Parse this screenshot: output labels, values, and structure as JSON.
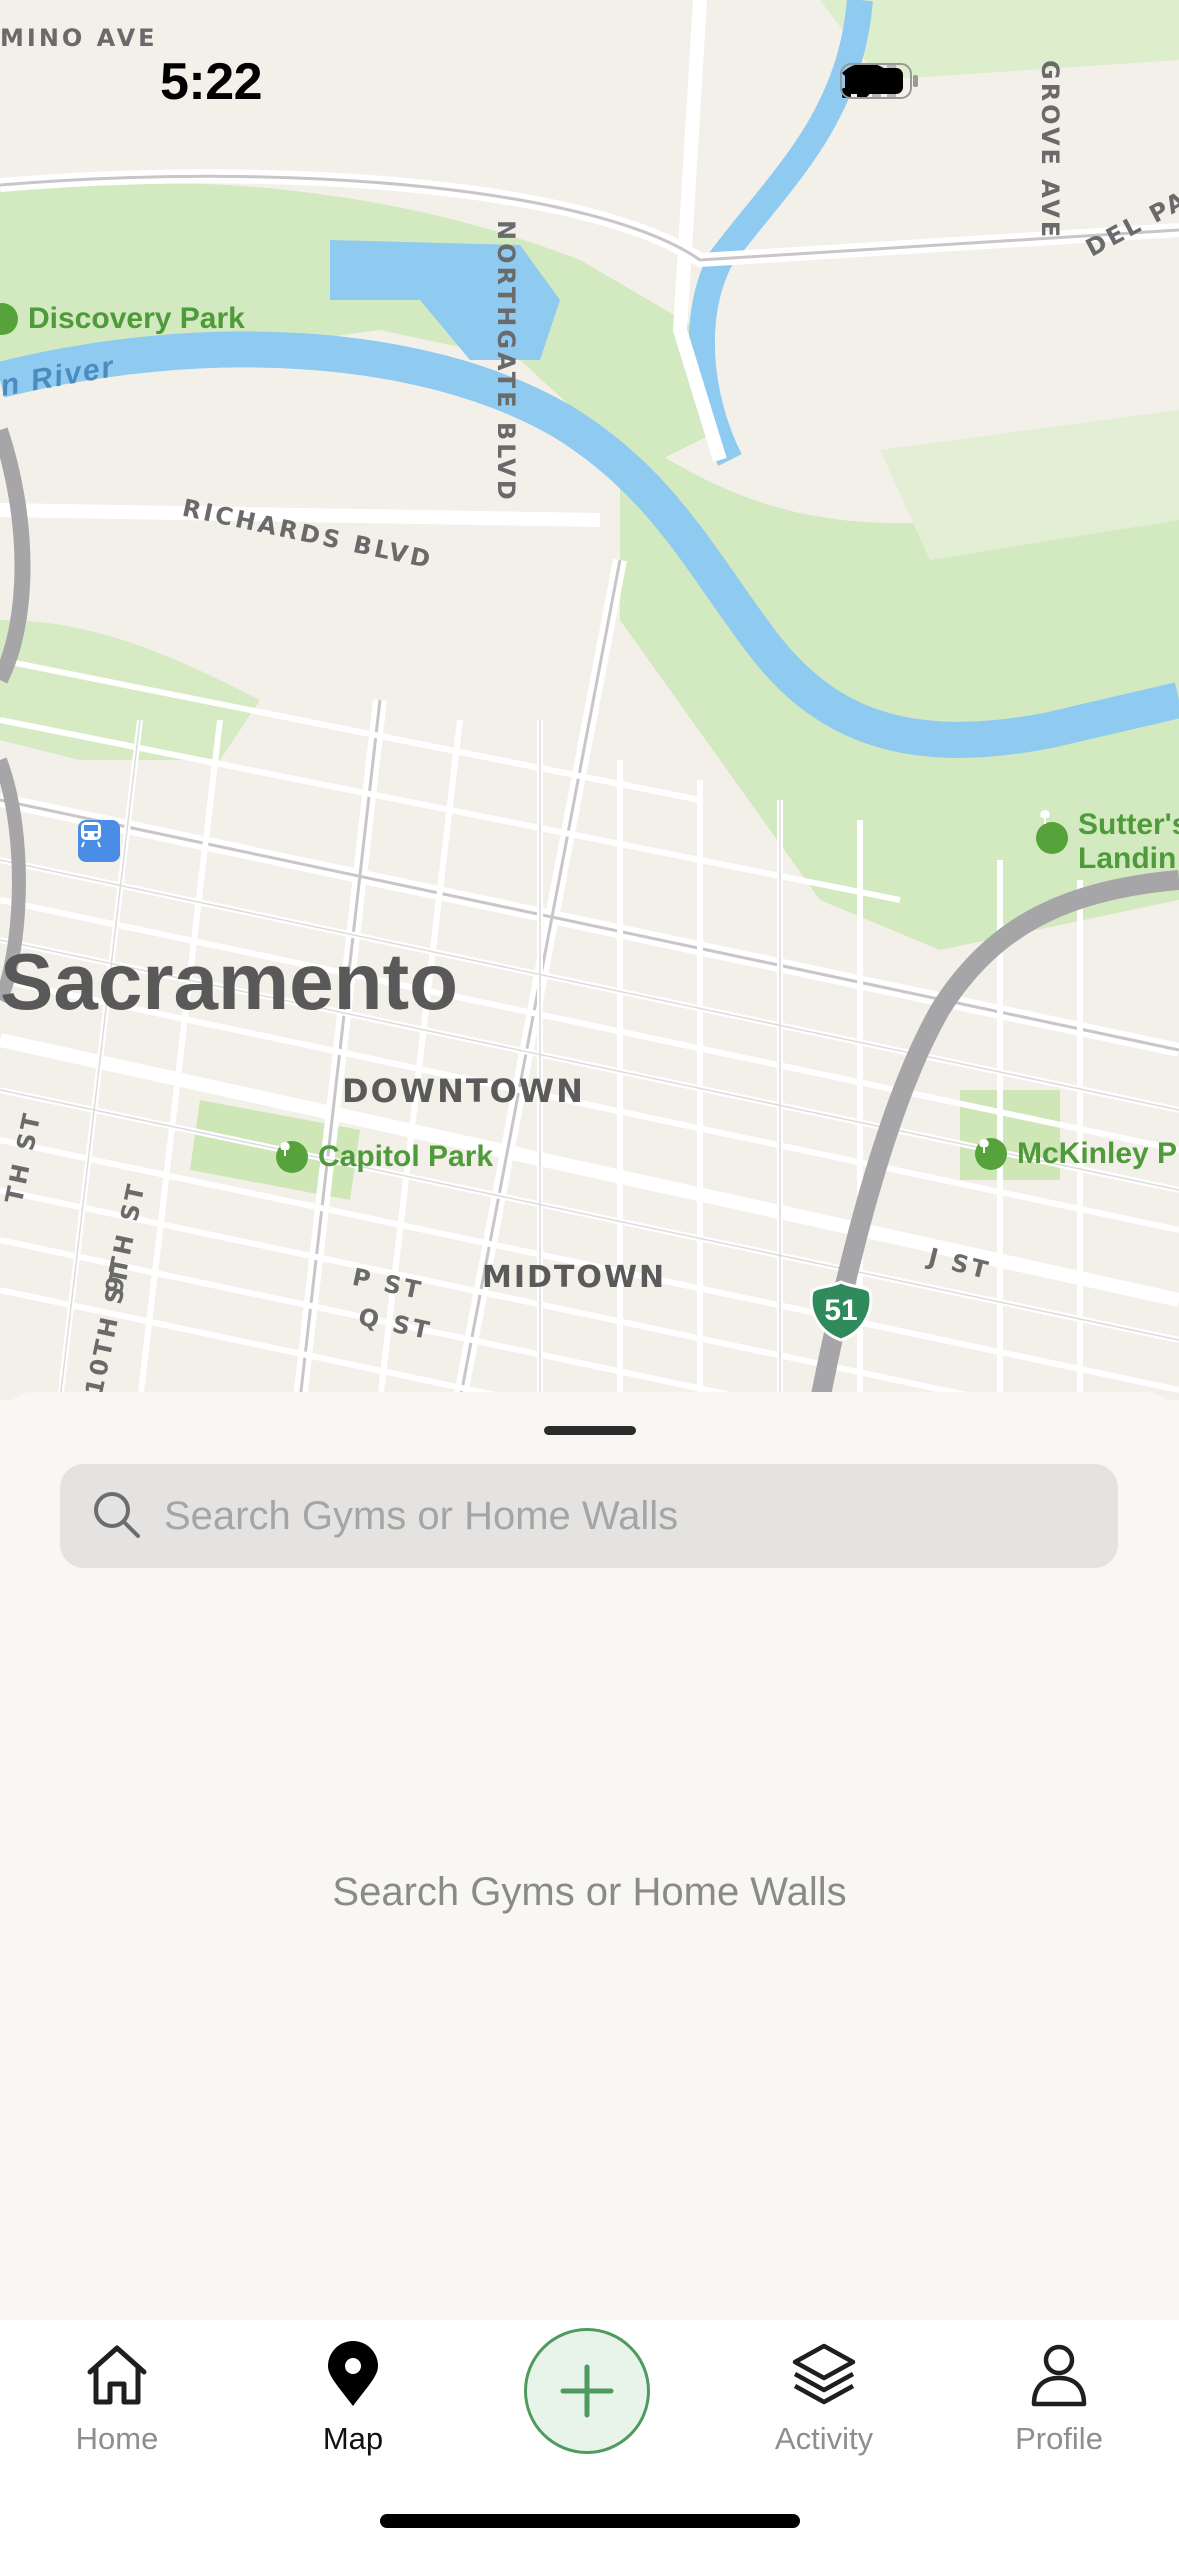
{
  "status_bar": {
    "time": "5:22"
  },
  "map": {
    "city": "Sacramento",
    "districts": [
      "DOWNTOWN",
      "MIDTOWN"
    ],
    "parks": [
      "Discovery Park",
      "Capitol Park",
      "McKinley P",
      "Sutter's",
      "Landin"
    ],
    "river": "n River",
    "roads": [
      "MINO AVE",
      "NORTHGATE BLVD",
      "GROVE AVE",
      "DEL PAS",
      "RICHARDS BLVD",
      "P ST",
      "Q ST",
      "9TH ST",
      "10TH ST",
      "J ST",
      "TH ST"
    ],
    "highway_shield": "51"
  },
  "sheet": {
    "search_placeholder": "Search Gyms or Home Walls",
    "empty_message": "Search Gyms or Home Walls"
  },
  "tabbar": {
    "items": [
      {
        "label": "Home",
        "icon": "home-icon",
        "active": false
      },
      {
        "label": "Map",
        "icon": "map-pin-icon",
        "active": true
      },
      {
        "label": "",
        "icon": "plus-icon",
        "active": false
      },
      {
        "label": "Activity",
        "icon": "layers-icon",
        "active": false
      },
      {
        "label": "Profile",
        "icon": "person-icon",
        "active": false
      }
    ]
  },
  "colors": {
    "accent": "#4f9a5f",
    "park": "#56a33c",
    "water": "#8fcaf0",
    "land": "#f3f0e9"
  }
}
